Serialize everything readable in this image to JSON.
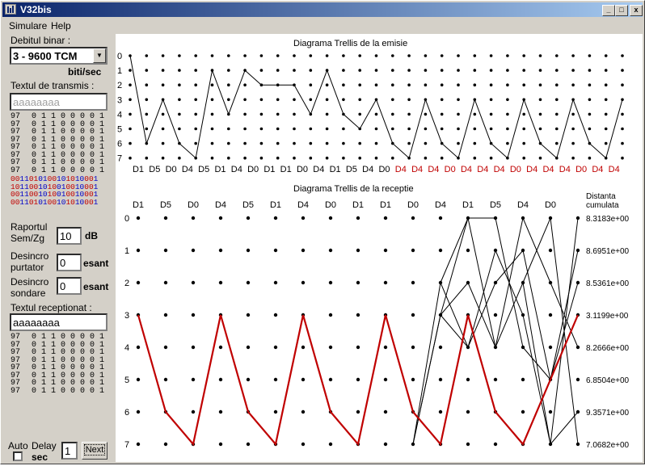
{
  "window": {
    "title": "V32bis",
    "icon": "app-icon",
    "min": "_",
    "max": "□",
    "close": "x"
  },
  "menu": [
    "Simulare",
    "Help"
  ],
  "left": {
    "rate_label": "Debitul binar :",
    "rate_value": "3 - 9600 TCM",
    "rate_unit": "biti/sec",
    "tx_label": "Textul de transmis :",
    "tx_placeholder": "aaaaaaaa",
    "tx_rows": [
      {
        "code": "97",
        "bits": "01100001"
      },
      {
        "code": "97",
        "bits": "01100001"
      },
      {
        "code": "97",
        "bits": "01100001"
      },
      {
        "code": "97",
        "bits": "01100001"
      },
      {
        "code": "97",
        "bits": "01100001"
      },
      {
        "code": "97",
        "bits": "01100001"
      },
      {
        "code": "97",
        "bits": "01100001"
      },
      {
        "code": "97",
        "bits": "01100001"
      }
    ],
    "stream_rows": [
      "0011010100101010001",
      "1011001010010010001",
      "0011001010010010001",
      "0011010100101010001"
    ],
    "snr_label1": "Raportul",
    "snr_label2": "Sem/Zg",
    "snr_value": "10",
    "snr_unit": "dB",
    "carrier_label1": "Desincro",
    "carrier_label2": "purtator",
    "carrier_value": "0",
    "carrier_unit": "esant",
    "probe_label1": "Desincro",
    "probe_label2": "sondare",
    "probe_value": "0",
    "probe_unit": "esant",
    "rx_label": "Textul receptionat :",
    "rx_value": "aaaaaaaa",
    "rx_rows": [
      {
        "code": "97",
        "bits": "01100001"
      },
      {
        "code": "97",
        "bits": "01100001"
      },
      {
        "code": "97",
        "bits": "01100001"
      },
      {
        "code": "97",
        "bits": "01100001"
      },
      {
        "code": "97",
        "bits": "01100001"
      },
      {
        "code": "97",
        "bits": "01100001"
      },
      {
        "code": "97",
        "bits": "01100001"
      },
      {
        "code": "97",
        "bits": "01100001"
      }
    ],
    "auto_label": "Auto",
    "delay_label": "Delay",
    "sec_label": "sec",
    "delay_value": "1",
    "next_label": "Next"
  },
  "tx_diagram": {
    "title": "Diagrama Trellis de la emisie",
    "state_labels": [
      "0",
      "1",
      "2",
      "3",
      "4",
      "5",
      "6",
      "7"
    ],
    "path": [
      0,
      6,
      3,
      6,
      7,
      1,
      4,
      1,
      2,
      2,
      2,
      4,
      1,
      4,
      5,
      3,
      6,
      7,
      3,
      6,
      7,
      3,
      6,
      7,
      3,
      6,
      7,
      3,
      6,
      7,
      3
    ],
    "symbols": [
      "D1",
      "D5",
      "D0",
      "D4",
      "D5",
      "D1",
      "D4",
      "D0",
      "D1",
      "D1",
      "D0",
      "D4",
      "D1",
      "D5",
      "D4",
      "D0",
      "D4",
      "D4",
      "D4",
      "D0",
      "D4",
      "D4",
      "D4",
      "D0",
      "D4",
      "D4",
      "D4",
      "D0",
      "D4",
      "D4",
      "D4"
    ],
    "symbol_colors": {
      "normal": "#000000",
      "tail": "#c00000"
    },
    "tail_start_index": 16
  },
  "rx_diagram": {
    "title": "Diagrama Trellis de la receptie",
    "symbols": [
      "D1",
      "D5",
      "D0",
      "D4",
      "D5",
      "D1",
      "D4",
      "D0",
      "D1",
      "D1",
      "D0",
      "D4",
      "D1",
      "D5",
      "D4",
      "D0"
    ],
    "state_labels": [
      "0",
      "1",
      "2",
      "3",
      "4",
      "5",
      "6",
      "7"
    ],
    "dist_header1": "Distanta",
    "dist_header2": "cumulata",
    "distances": [
      "8.3183e+00",
      "8.6951e+00",
      "8.5361e+00",
      "3.1199e+00",
      "8.2666e+00",
      "6.8504e+00",
      "9.3571e+00",
      "7.0682e+00"
    ],
    "best_path": [
      3,
      6,
      7,
      3,
      6,
      7,
      3,
      6,
      7,
      3,
      6,
      7,
      3,
      6,
      7,
      5,
      3
    ],
    "best_color": "#c00000",
    "survivors": [
      [
        [
          10,
          7
        ],
        [
          11,
          3
        ],
        [
          12,
          0
        ],
        [
          13,
          0
        ],
        [
          14,
          4
        ],
        [
          15,
          5
        ],
        [
          16,
          3
        ]
      ],
      [
        [
          10,
          7
        ],
        [
          11,
          2
        ],
        [
          12,
          4
        ],
        [
          13,
          2
        ],
        [
          14,
          1
        ],
        [
          15,
          5
        ]
      ],
      [
        [
          10,
          7
        ],
        [
          11,
          3
        ],
        [
          12,
          4
        ],
        [
          13,
          1
        ],
        [
          14,
          3
        ],
        [
          15,
          7
        ],
        [
          16,
          6
        ]
      ],
      [
        [
          11,
          2
        ],
        [
          12,
          0
        ],
        [
          13,
          4
        ],
        [
          14,
          0
        ],
        [
          15,
          2
        ],
        [
          16,
          4
        ]
      ],
      [
        [
          11,
          3
        ],
        [
          12,
          2
        ],
        [
          13,
          4
        ],
        [
          14,
          2
        ],
        [
          15,
          0
        ],
        [
          16,
          7
        ]
      ],
      [
        [
          15,
          5
        ],
        [
          16,
          1
        ]
      ],
      [
        [
          15,
          5
        ],
        [
          16,
          2
        ]
      ],
      [
        [
          14,
          2
        ],
        [
          15,
          7
        ],
        [
          16,
          0
        ]
      ]
    ]
  }
}
